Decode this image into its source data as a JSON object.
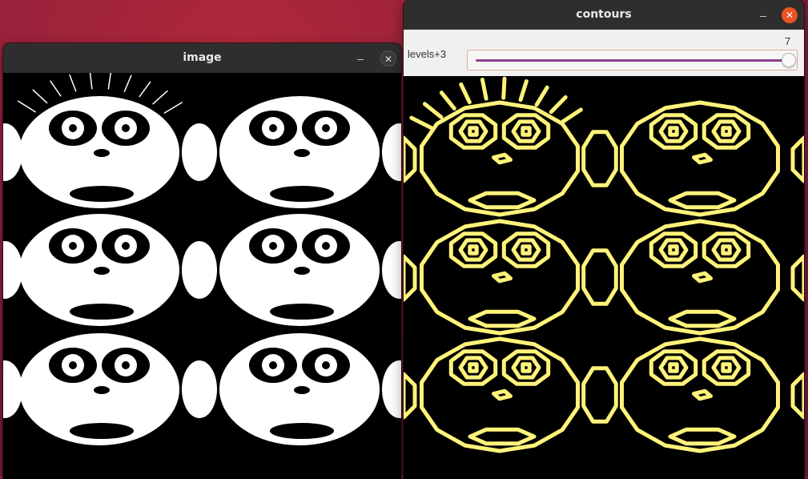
{
  "windows": {
    "image": {
      "title": "image",
      "minimize_glyph": "–",
      "close_glyph": "✕"
    },
    "contours": {
      "title": "contours",
      "minimize_glyph": "–",
      "close_glyph": "✕"
    }
  },
  "trackbar": {
    "label": "levels+3",
    "value": "7",
    "max": 7,
    "fill_fraction": 1.0
  },
  "colors": {
    "contour_color": "#fff37a",
    "slider_fill": "#8e3f8e",
    "close_button_active": "#e95420",
    "titlebar": "#2e2e2e"
  },
  "icons": {
    "minimize": "minimize-icon",
    "close": "close-icon"
  }
}
